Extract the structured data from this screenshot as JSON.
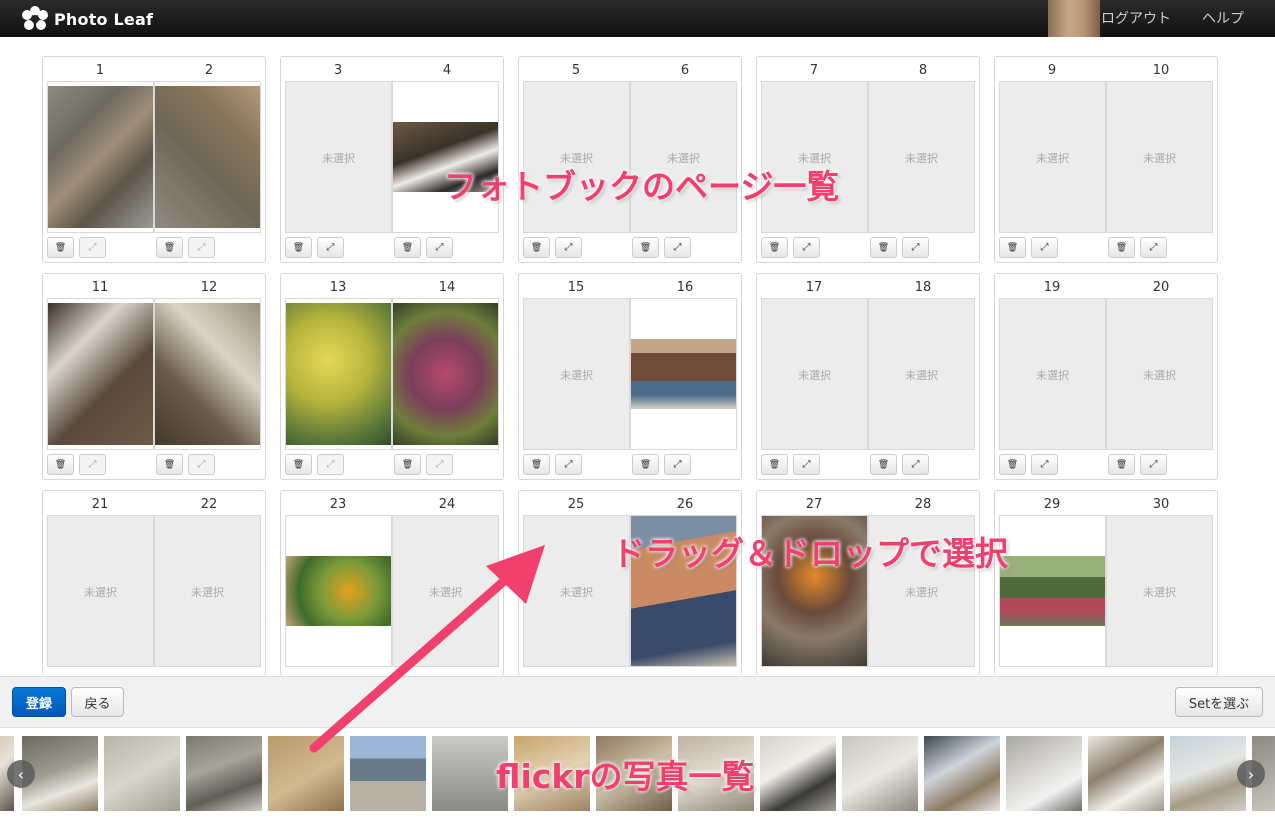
{
  "header": {
    "logo_text": "Photo Leaf",
    "logout": "ログアウト",
    "help": "ヘルプ"
  },
  "empty_label": "未選択",
  "spreads": [
    {
      "left": "1",
      "right": "2"
    },
    {
      "left": "3",
      "right": "4"
    },
    {
      "left": "5",
      "right": "6"
    },
    {
      "left": "7",
      "right": "8"
    },
    {
      "left": "9",
      "right": "10"
    },
    {
      "left": "11",
      "right": "12"
    },
    {
      "left": "13",
      "right": "14"
    },
    {
      "left": "15",
      "right": "16"
    },
    {
      "left": "17",
      "right": "18"
    },
    {
      "left": "19",
      "right": "20"
    },
    {
      "left": "21",
      "right": "22"
    },
    {
      "left": "23",
      "right": "24"
    },
    {
      "left": "25",
      "right": "26"
    },
    {
      "left": "27",
      "right": "28"
    },
    {
      "left": "29",
      "right": "30"
    }
  ],
  "annotations": {
    "pages": "フォトブックのページ一覧",
    "dragdrop": "ドラッグ＆ドロップで選択",
    "flickr": "flickrの写真一覧"
  },
  "actions": {
    "register": "登録",
    "back": "戻る",
    "choose_set": "Setを選ぶ"
  },
  "icons": {
    "delete": "trash-icon",
    "expand": "expand-icon",
    "prev": "chevron-left-icon",
    "next": "chevron-right-icon"
  },
  "colors": {
    "primary": "#0a6fd0",
    "annotation": "#f2406e",
    "topbar": "#1a1a1a"
  }
}
